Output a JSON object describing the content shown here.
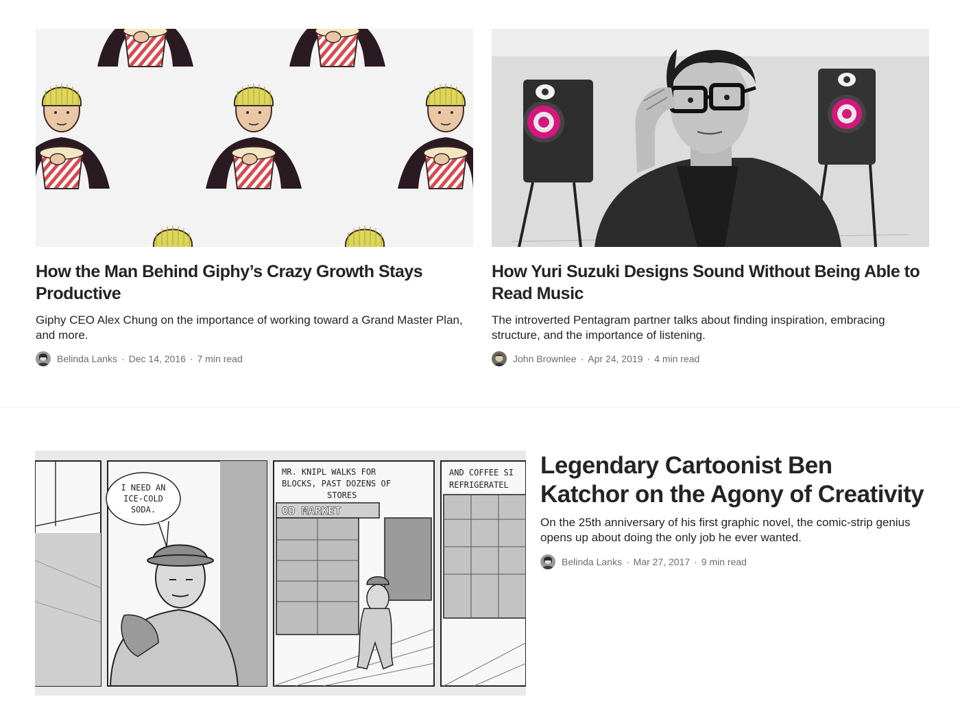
{
  "articles": [
    {
      "title": "How the Man Behind Giphy’s Crazy Growth Stays Productive",
      "subtitle": "Giphy CEO Alex Chung on the importance of working toward a Grand Master Plan, and more.",
      "author": "Belinda Lanks",
      "date": "Dec 14, 2016",
      "read_time": "7 min read"
    },
    {
      "title": "How Yuri Suzuki Designs Sound Without Being Able to Read Music",
      "subtitle": "The introverted Pentagram partner talks about finding inspiration, embracing structure, and the importance of listening.",
      "author": "John Brownlee",
      "date": "Apr 24, 2019",
      "read_time": "4 min read"
    },
    {
      "title": "Legendary Cartoonist Ben Katchor on the Agony of Creativity",
      "subtitle": "On the 25th anniversary of his first graphic novel, the comic-strip genius opens up about doing the only job he ever wanted.",
      "author": "Belinda Lanks",
      "date": "Mar 27, 2017",
      "read_time": "9 min read"
    }
  ],
  "comic_text": {
    "bubble": [
      "I NEED AN",
      "ICE-COLD",
      "SODA."
    ],
    "caption1": [
      "MR. KNIPL WALKS FOR",
      "BLOCKS, PAST DOZENS OF",
      "STORES"
    ],
    "caption2": [
      "AND COFFEE SI",
      "REFRIGERATEL"
    ],
    "market_sign": "OD MARKET"
  },
  "colors": {
    "text": "#242424",
    "meta": "#6b6b6b",
    "accent_pink": "#d6167f",
    "hat_yellow": "#dcd65a"
  }
}
